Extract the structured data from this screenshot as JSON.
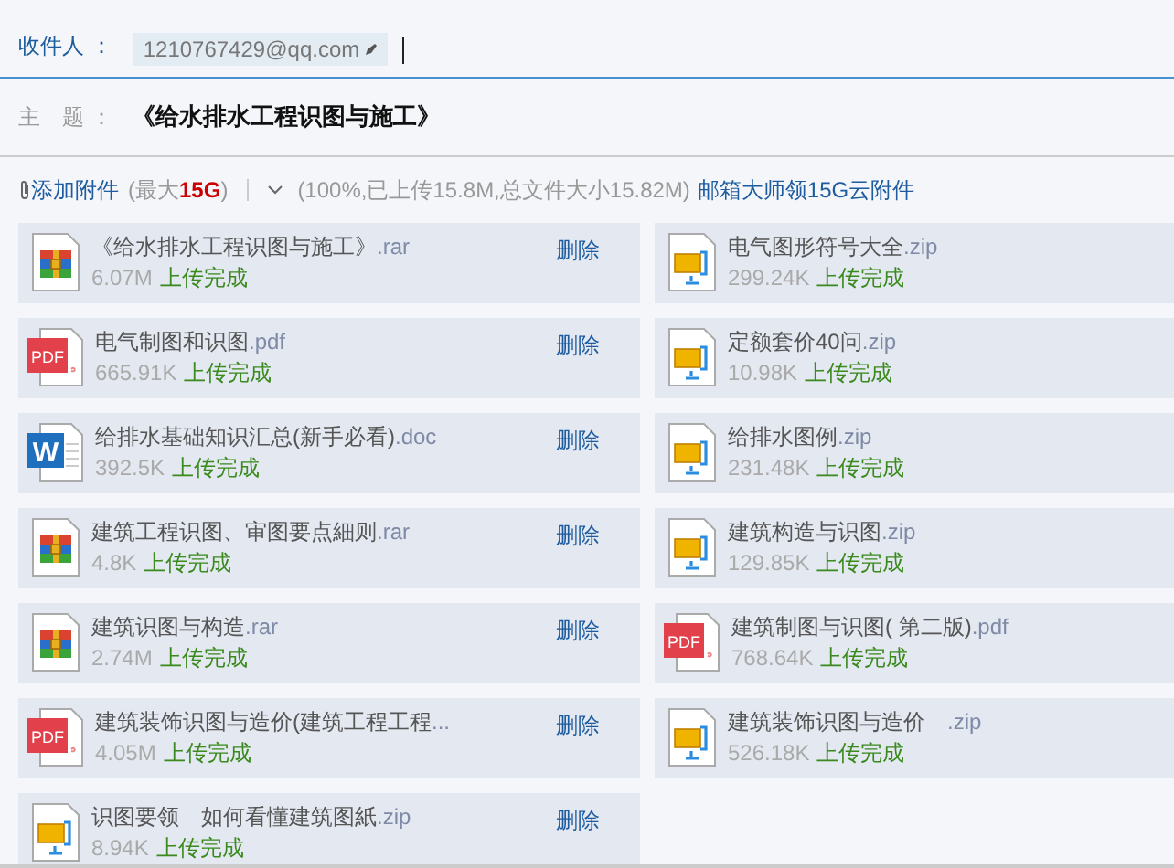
{
  "recipient": {
    "label": "收件人 ：",
    "address": "1210767429@qq.com"
  },
  "subject": {
    "label": "主　题 ：",
    "value": "《给水排水工程识图与施工》"
  },
  "attach_bar": {
    "add": "添加附件",
    "limit_prefix": "(最大",
    "limit": "15G",
    "limit_suffix": ")",
    "summary": "(100%,已上传15.8M,总文件大小15.82M)",
    "promo": "邮箱大师领15G云附件"
  },
  "files": [
    {
      "kind": "rar",
      "name": "《给水排水工程识图与施工》",
      "ext": ".rar",
      "size": "6.07M",
      "status": "上传完成",
      "delete": "删除"
    },
    {
      "kind": "zip",
      "name": "电气图形符号大全",
      "ext": ".zip",
      "size": "299.24K",
      "status": "上传完成"
    },
    {
      "kind": "pdf",
      "badge": "PDF",
      "name": "电气制图和识图",
      "ext": ".pdf",
      "size": "665.91K",
      "status": "上传完成",
      "delete": "删除"
    },
    {
      "kind": "zip",
      "name": "定额套价40问",
      "ext": ".zip",
      "size": "10.98K",
      "status": "上传完成"
    },
    {
      "kind": "doc",
      "badge": "W",
      "name": "给排水基础知识汇总(新手必看)",
      "ext": ".doc",
      "size": "392.5K",
      "status": "上传完成",
      "delete": "删除"
    },
    {
      "kind": "zip",
      "name": "给排水图例",
      "ext": ".zip",
      "size": "231.48K",
      "status": "上传完成"
    },
    {
      "kind": "rar",
      "name": "建筑工程识图、审图要点細则",
      "ext": ".rar",
      "size": "4.8K",
      "status": "上传完成",
      "delete": "删除"
    },
    {
      "kind": "zip",
      "name": "建筑构造与识图",
      "ext": ".zip",
      "size": "129.85K",
      "status": "上传完成"
    },
    {
      "kind": "rar",
      "name": "建筑识图与构造",
      "ext": ".rar",
      "size": "2.74M",
      "status": "上传完成",
      "delete": "删除"
    },
    {
      "kind": "pdf",
      "badge": "PDF",
      "name": "建筑制图与识图( 第二版)",
      "ext": ".pdf",
      "size": "768.64K",
      "status": "上传完成"
    },
    {
      "kind": "pdf",
      "badge": "PDF",
      "name": "建筑装饰识图与造价(建筑工程工程",
      "ext": "...",
      "size": "4.05M",
      "status": "上传完成",
      "delete": "删除"
    },
    {
      "kind": "zip",
      "name": "建筑装饰识图与造价　",
      "ext": ".zip",
      "size": "526.18K",
      "status": "上传完成"
    },
    {
      "kind": "zip",
      "name": "识图要领　如何看懂建筑图紙",
      "ext": ".zip",
      "size": "8.94K",
      "status": "上传完成",
      "delete": "删除"
    }
  ]
}
